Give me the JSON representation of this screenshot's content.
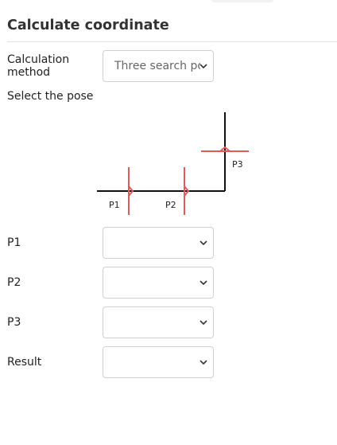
{
  "title": "Calculate coordinate",
  "calculation_method": {
    "label": "Calculation method",
    "value": "Three search points"
  },
  "pose": {
    "label": "Select the pose",
    "points": [
      "P1",
      "P2",
      "P3"
    ]
  },
  "fields": [
    {
      "label": "P1",
      "value": ""
    },
    {
      "label": "P2",
      "value": ""
    },
    {
      "label": "P3",
      "value": ""
    },
    {
      "label": "Result",
      "value": ""
    }
  ],
  "colors": {
    "search_point": "#e05a5a",
    "frame_line": "#111111",
    "border": "#cfcfcf"
  },
  "icons": {
    "dropdown": "chevron-down-icon"
  }
}
